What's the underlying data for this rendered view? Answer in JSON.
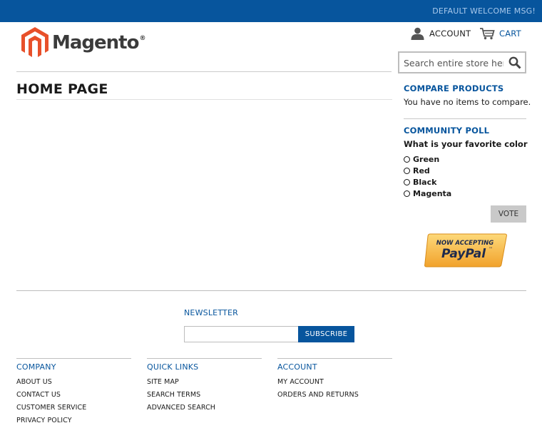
{
  "header": {
    "welcome": "DEFAULT WELCOME MSG!",
    "logo_text": "Magento",
    "logo_mark": "®",
    "account_label": "ACCOUNT",
    "cart_label": "CART"
  },
  "search": {
    "placeholder": "Search entire store here..."
  },
  "main": {
    "page_title": "HOME PAGE"
  },
  "sidebar": {
    "compare": {
      "title": "COMPARE PRODUCTS",
      "text": "You have no items to compare."
    },
    "poll": {
      "title": "COMMUNITY POLL",
      "question": "What is your favorite color",
      "options": [
        "Green",
        "Red",
        "Black",
        "Magenta"
      ],
      "vote_label": "VOTE"
    },
    "paypal": {
      "line1": "NOW ACCEPTING",
      "line2": "PayPal",
      "tm": "™"
    }
  },
  "footer": {
    "newsletter": {
      "title": "NEWSLETTER",
      "subscribe_label": "SUBSCRIBE"
    },
    "columns": [
      {
        "title": "COMPANY",
        "links": [
          "ABOUT US",
          "CONTACT US",
          "CUSTOMER SERVICE",
          "PRIVACY POLICY"
        ]
      },
      {
        "title": "QUICK LINKS",
        "links": [
          "SITE MAP",
          "SEARCH TERMS",
          "ADVANCED SEARCH"
        ]
      },
      {
        "title": "ACCOUNT",
        "links": [
          "MY ACCOUNT",
          "ORDERS AND RETURNS"
        ]
      }
    ]
  },
  "colors": {
    "brand_blue": "#07559d",
    "logo_orange": "#e8502a",
    "paypal_gold": "#f7b733"
  },
  "icons": {
    "account": "user-icon",
    "cart": "cart-icon",
    "search": "magnifier-icon"
  }
}
